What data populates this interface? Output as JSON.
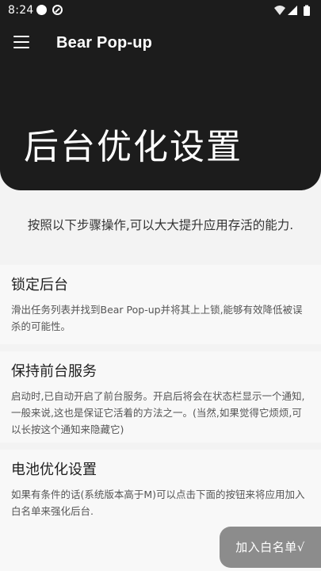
{
  "status_bar": {
    "time": "8:24"
  },
  "header": {
    "app_title": "Bear Pop-up",
    "page_title": "后台优化设置",
    "background_color": "#1c1c1c"
  },
  "intro": {
    "text": "按照以下步骤操作,可以大大提升应用存活的能力."
  },
  "cards": [
    {
      "title": "锁定后台",
      "description": "滑出任务列表并找到Bear Pop-up并将其上上锁,能够有效降低被误杀的可能性。"
    },
    {
      "title": "保持前台服务",
      "description": "启动时,已自动开启了前台服务。开启后将会在状态栏显示一个通知,一般来说,这也是保证它活着的方法之一。(当然,如果觉得它烦烦,可以长按这个通知来隐藏它)"
    },
    {
      "title": "电池优化设置",
      "description": "如果有条件的话(系统版本高于M)可以点击下面的按钮来将应用加入白名单来强化后台."
    }
  ],
  "actions": {
    "whitelist_label": "加入白名单√",
    "button_color": "#8c8c8c"
  },
  "icons": {
    "menu": "hamburger-menu-icon",
    "wifi": "wifi-icon",
    "signal": "cell-signal-icon",
    "battery": "battery-icon"
  }
}
